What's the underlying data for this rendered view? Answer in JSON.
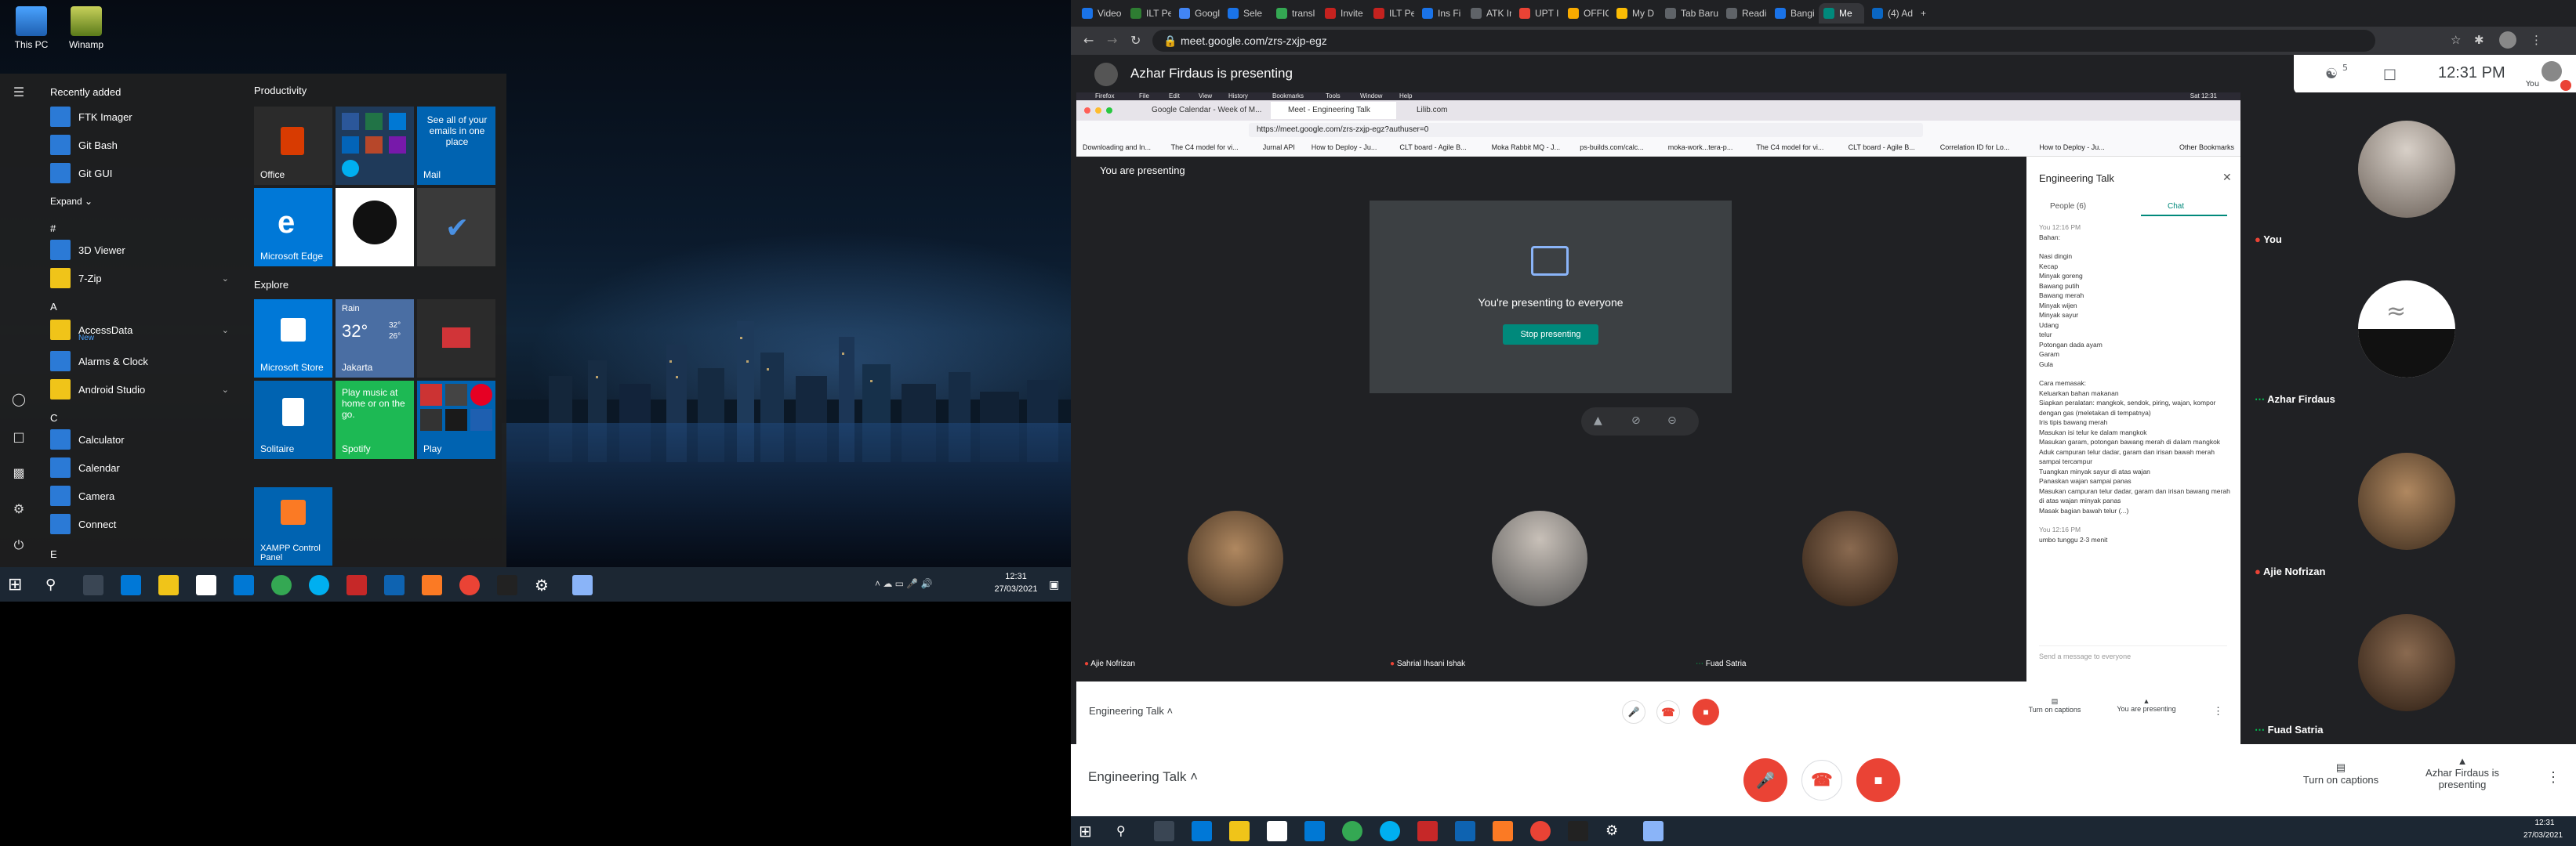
{
  "desktop": {
    "icons": [
      {
        "label": "This PC",
        "icon": "computer-icon"
      },
      {
        "label": "Winamp",
        "icon": "winamp-icon"
      }
    ]
  },
  "start_menu": {
    "recently_added": "Recently added",
    "recent_apps": [
      "FTK Imager",
      "Git Bash",
      "Git GUI"
    ],
    "expand": "Expand",
    "sections": [
      {
        "letter": "#",
        "apps": [
          {
            "name": "3D Viewer"
          },
          {
            "name": "7-Zip",
            "expandable": true
          }
        ]
      },
      {
        "letter": "A",
        "apps": [
          {
            "name": "AccessData",
            "sub": "New",
            "expandable": true
          },
          {
            "name": "Alarms & Clock"
          },
          {
            "name": "Android Studio",
            "expandable": true
          }
        ]
      },
      {
        "letter": "C",
        "apps": [
          {
            "name": "Calculator"
          },
          {
            "name": "Calendar"
          },
          {
            "name": "Camera"
          },
          {
            "name": "Connect"
          }
        ]
      },
      {
        "letter": "E",
        "apps": []
      }
    ],
    "groups": {
      "productivity": "Productivity",
      "explore": "Explore"
    },
    "tiles": {
      "office": "Office",
      "mail_promo": "See all of your emails in one place",
      "mail": "Mail",
      "edge": "Microsoft Edge",
      "store": "Microsoft Store",
      "weather_cond": "Rain",
      "weather_temp": "32°",
      "weather_hi": "32°",
      "weather_lo": "26°",
      "weather_city": "Jakarta",
      "solitaire": "Solitaire",
      "spotify_promo": "Play music at home or on the go.",
      "spotify": "Spotify",
      "play": "Play",
      "xampp": "XAMPP Control Panel"
    }
  },
  "taskbar_left": {
    "time": "12:31",
    "date": "27/03/2021"
  },
  "browser": {
    "tabs": [
      "Video",
      "ILT Pe",
      "Googl",
      "Sele",
      "transl",
      "Invite",
      "ILT Pe",
      "Ins Fi",
      "ATK In",
      "UPT I",
      "OFFIC",
      "My D",
      "Tab Baru",
      "Readi",
      "Bangi",
      "Me",
      "(4) Ad"
    ],
    "url": "meet.google.com/zrs-zxjp-egz"
  },
  "meet": {
    "presenting_banner": "Azhar Firdaus is presenting",
    "participant_count": "5",
    "clock": "12:31 PM",
    "you_label": "You",
    "meeting_name": "Engineering Talk",
    "captions": "Turn on captions",
    "presenter_status": "Azhar Firdaus is presenting",
    "side_tiles": [
      {
        "name": "You",
        "muted": true
      },
      {
        "name": "Azhar Firdaus",
        "muted": false
      },
      {
        "name": "Ajie Nofrizan",
        "muted": true
      },
      {
        "name": "Fuad Satria",
        "muted": false
      }
    ]
  },
  "inner": {
    "mac_menu": [
      "Firefox",
      "File",
      "Edit",
      "View",
      "History",
      "Bookmarks",
      "Tools",
      "Window",
      "Help"
    ],
    "mac_status": "Sat 12:31",
    "ff_tabs": [
      "Google Calendar - Week of M...",
      "Meet - Engineering Talk",
      "Lilib.com"
    ],
    "ff_url": "https://meet.google.com/zrs-zxjp-egz?authuser=0",
    "bookmarks": [
      "Downloading and In...",
      "The C4 model for vi...",
      "Jurnal API",
      "How to Deploy - Ju...",
      "CLT board - Agile B...",
      "Moka Rabbit MQ - J...",
      "ps-builds.com/calc...",
      "moka-work...tera-p...",
      "The C4 model for vi...",
      "CLT board - Agile B...",
      "Correlation ID for Lo...",
      "How to Deploy - Ju...",
      "Other Bookmarks"
    ],
    "you_are_presenting": "You are presenting",
    "presenting_to_everyone": "You're presenting to everyone",
    "stop_presenting": "Stop presenting",
    "participants": [
      "Ajie Nofrizan",
      "Sahrial Ihsani Ishak",
      "Fuad Satria"
    ],
    "meeting_name": "Engineering Talk",
    "captions": "Turn on captions",
    "you_presenting_btn": "You are presenting"
  },
  "chat": {
    "title": "Engineering Talk",
    "people_tab": "People (6)",
    "chat_tab": "Chat",
    "sender_time": "You 12:16 PM",
    "bahan_title": "Bahan:",
    "ingredients": [
      "Nasi dingin",
      "Kecap",
      "Minyak goreng",
      "Bawang putih",
      "Bawang merah",
      "Minyak wijen",
      "Minyak sayur",
      "Udang",
      "telur",
      "Potongan dada ayam",
      "Garam",
      "Gula"
    ],
    "cara_title": "Cara memasak:",
    "steps": [
      "Keluarkan bahan makanan",
      "Siapkan peralatan: mangkok, sendok, piring, wajan, kompor dengan gas (meletakan di tempatnya)",
      "Iris tipis bawang merah",
      "Masukan isi telur ke dalam mangkok",
      "Masukan garam, potongan bawang merah di dalam mangkok",
      "Aduk campuran telur dadar, garam dan irisan bawah merah sampai tercampur",
      "Tuangkan minyak sayur di atas wajan",
      "Panaskan wajan sampai panas",
      "Masukan campuran telur dadar, garam dan irisan bawang merah di atas wajan minyak panas",
      "Masak bagian bawah telur (...)"
    ],
    "last_sender": "You 12:16 PM",
    "last_msg": "umbo tunggu 2-3 menit",
    "placeholder": "Send a message to everyone"
  },
  "taskbar_right": {
    "time": "12:31",
    "date": "27/03/2021"
  },
  "colors": {
    "meet_red": "#ea4335",
    "accent": "#1a73e8",
    "teal": "#00897b"
  }
}
